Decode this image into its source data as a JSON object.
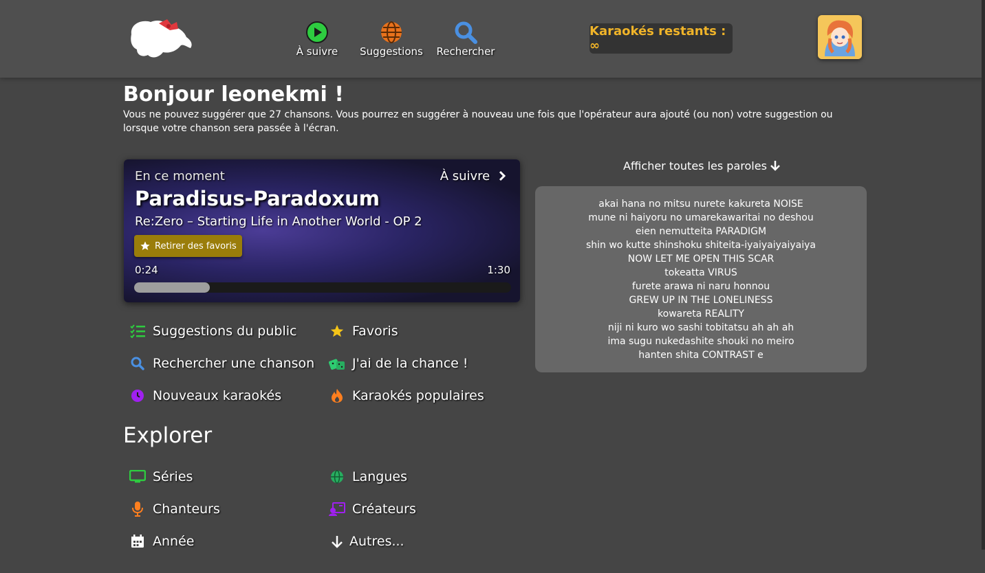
{
  "nav": {
    "up_next_label": "À suivre",
    "suggestions_label": "Suggestions",
    "search_label": "Rechercher",
    "remaining_label": "Karaokés restants : ∞"
  },
  "greeting": "Bonjour leonekmi !",
  "info_text": "Vous ne pouvez suggérer que 27 chansons. Vous pourrez en suggérer à nouveau une fois que l'opérateur aura ajouté (ou non) votre suggestion ou lorsque votre chanson sera passée à l'écran.",
  "player": {
    "now_label": "En ce moment",
    "next_label": "À suivre",
    "song_title": "Paradisus-Paradoxum",
    "song_series": "Re:Zero – Starting Life in Another World - OP 2",
    "favorite_button": "Retirer des favoris",
    "time_elapsed": "0:24",
    "time_total": "1:30",
    "progress": 0.2
  },
  "quick_links": [
    {
      "label": "Suggestions du public",
      "icon": "list-check-icon",
      "color": "#2ecc40"
    },
    {
      "label": "Favoris",
      "icon": "star-icon",
      "color": "#f5c518"
    },
    {
      "label": "Rechercher une chanson",
      "icon": "search-icon",
      "color": "#4a90e2"
    },
    {
      "label": "J'ai de la chance !",
      "icon": "dice-icon",
      "color": "#2ecc71"
    },
    {
      "label": "Nouveaux karaokés",
      "icon": "clock-icon",
      "color": "#a020f0"
    },
    {
      "label": "Karaokés populaires",
      "icon": "fire-icon",
      "color": "#ff7f1f"
    }
  ],
  "explorer_title": "Explorer",
  "explore_links": [
    {
      "label": "Séries",
      "icon": "tv-icon",
      "color": "#2ecc40"
    },
    {
      "label": "Langues",
      "icon": "globe-icon",
      "color": "#27ae60"
    },
    {
      "label": "Chanteurs",
      "icon": "microphone-icon",
      "color": "#ff7f1f"
    },
    {
      "label": "Créateurs",
      "icon": "creators-icon",
      "color": "#a020f0"
    },
    {
      "label": "Année",
      "icon": "calendar-icon",
      "color": "#ffffff"
    },
    {
      "label": "Autres...",
      "icon": "arrow-down-icon",
      "color": "#ffffff"
    }
  ],
  "lyrics": {
    "toggle_label": "Afficher toutes les paroles",
    "lines": [
      "akai hana no mitsu nurete kakureta NOISE",
      "mune ni haiyoru no umarekawaritai no deshou",
      "eien nemutteita PARADIGM",
      "shin wo kutte shinshoku shiteita-iyaiyaiyaiyaiya",
      "NOW LET ME OPEN THIS SCAR",
      "tokeatta VIRUS",
      "furete arawa ni naru honnou",
      "GREW UP IN THE LONELINESS",
      "kowareta REALITY",
      "niji ni kuro wo sashi tobitatsu ah ah ah",
      "ima sugu nukedashite shouki no meiro",
      "hanten shita CONTRAST e"
    ]
  }
}
